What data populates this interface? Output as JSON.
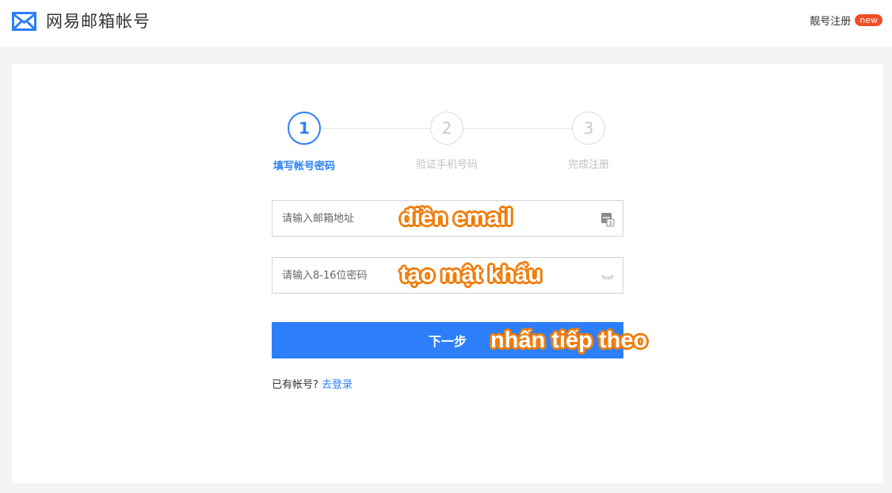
{
  "header": {
    "logo_text": "网易邮箱帐号",
    "premium_link": "靓号注册",
    "new_badge": "new",
    "brand_color": "#2d7ff9"
  },
  "steps": [
    {
      "number": "1",
      "label": "填写帐号密码",
      "active": true
    },
    {
      "number": "2",
      "label": "验证手机号码",
      "active": false
    },
    {
      "number": "3",
      "label": "完成注册",
      "active": false
    }
  ],
  "form": {
    "email": {
      "value": "",
      "placeholder": "请输入邮箱地址",
      "icon": "contact-card-icon"
    },
    "password": {
      "value": "",
      "placeholder": "请输入8-16位密码",
      "icon": "eye-closed-icon"
    },
    "next_label": "下一步",
    "login_prompt": "已有帐号?",
    "login_link": "去登录"
  },
  "annotations": {
    "email": "điền email",
    "password": "tạo mật khẩu",
    "next": "nhấn tiếp theo",
    "color": "#f07d0b"
  }
}
